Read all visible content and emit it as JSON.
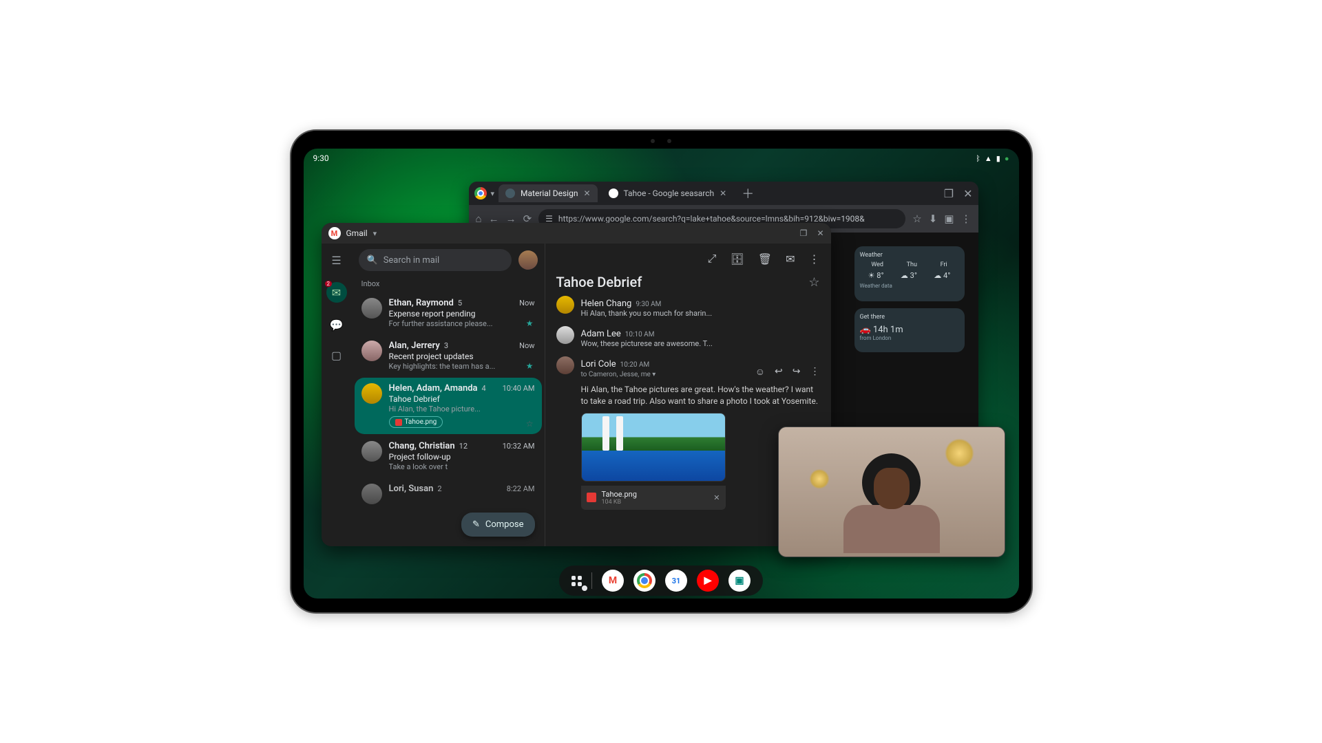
{
  "status": {
    "time": "9:30"
  },
  "chrome": {
    "tabs": [
      {
        "title": "Material Design"
      },
      {
        "title": "Tahoe - Google seasarch"
      }
    ],
    "url": "https://www.google.com/search?q=lake+tahoe&source=lmns&bih=912&biw=1908&",
    "weather": {
      "label": "Weather",
      "days": [
        {
          "d": "Wed",
          "t": "8°"
        },
        {
          "d": "Thu",
          "t": "3°"
        },
        {
          "d": "Fri",
          "t": "4°"
        }
      ],
      "footer": "Weather data"
    },
    "directions": {
      "label": "Get there",
      "duration": "14h 1m",
      "from": "from London"
    }
  },
  "gmail": {
    "app": "Gmail",
    "search_placeholder": "Search in mail",
    "mail_badge": "2",
    "inbox_label": "Inbox",
    "compose": "Compose",
    "emails": [
      {
        "sender": "Ethan, Raymond",
        "count": "5",
        "time": "Now",
        "subject": "Expense report pending",
        "preview": "For further assistance please...",
        "starred": true
      },
      {
        "sender": "Alan, Jerrery",
        "count": "3",
        "time": "Now",
        "subject": "Recent project updates",
        "preview": "Key highlights: the team has a...",
        "starred": true
      },
      {
        "sender": "Helen, Adam, Amanda",
        "count": "4",
        "time": "10:40 AM",
        "subject": "Tahoe Debrief",
        "preview": "Hi Alan, the Tahoe picture...",
        "attachment": "Tahoe.png",
        "starred": false
      },
      {
        "sender": "Chang, Christian",
        "count": "12",
        "time": "10:32 AM",
        "subject": "Project follow-up",
        "preview": "Take a look over t"
      },
      {
        "sender": "Lori, Susan",
        "count": "2",
        "time": "8:22 AM",
        "subject": "",
        "preview": ""
      }
    ],
    "reader": {
      "title": "Tahoe Debrief",
      "messages": [
        {
          "name": "Helen Chang",
          "time": "9:30 AM",
          "preview": "Hi Alan, thank you so much for sharin..."
        },
        {
          "name": "Adam Lee",
          "time": "10:10 AM",
          "preview": "Wow, these picturese are awesome. T..."
        },
        {
          "name": "Lori Cole",
          "time": "10:20 AM",
          "recipients": "to Cameron, Jesse, me",
          "body": "Hi Alan, the Tahoe pictures are great. How's the weather? I want to take a road trip. Also want to share a photo I took at Yosemite."
        }
      ],
      "attachment": {
        "name": "Tahoe.png",
        "size": "104 KB"
      }
    }
  },
  "taskbar": {
    "apps": [
      "Gmail",
      "Chrome",
      "Calendar",
      "YouTube",
      "Meet"
    ]
  }
}
